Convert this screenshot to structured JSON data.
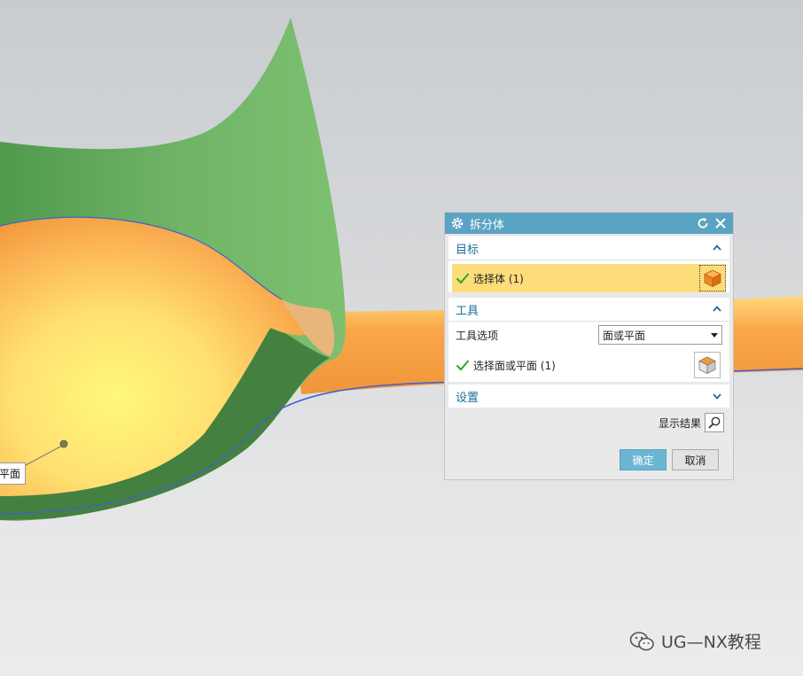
{
  "dialog": {
    "title": "拆分体",
    "target": {
      "header": "目标",
      "select_body": "选择体 (1)"
    },
    "tool": {
      "header": "工具",
      "option_label": "工具选项",
      "option_value": "面或平面",
      "select_face": "选择面或平面 (1)"
    },
    "settings": {
      "header": "设置"
    },
    "preview_label": "显示结果",
    "ok_label": "确定",
    "cancel_label": "取消"
  },
  "viewport": {
    "callout_text": "平面"
  },
  "watermark": {
    "text": "UG—NX教程"
  },
  "colors": {
    "title_bar": "#5aa3c2",
    "section_header_text": "#1c6fa0",
    "selection_highlight": "#fddd7a",
    "sheet_green": "#5fa85a",
    "body_orange": "#f5a54a",
    "body_yellow": "#fff27a"
  }
}
